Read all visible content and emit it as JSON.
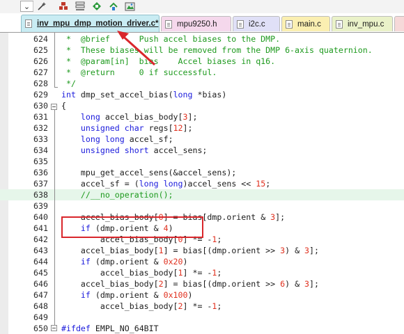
{
  "toolbar": {
    "icons": [
      "dropdown-chevron",
      "wand-icon",
      "build-icon",
      "rebuild-icon",
      "target-icon",
      "manage-icon",
      "pack-installer-icon"
    ]
  },
  "tabs": [
    {
      "label": "inv_mpu_dmp_motion_driver.c*",
      "active": true,
      "color": "#c9ecf3"
    },
    {
      "label": "mpu9250.h",
      "active": false,
      "color": "#f5d8ec"
    },
    {
      "label": "i2c.c",
      "active": false,
      "color": "#e0e0f7"
    },
    {
      "label": "main.c",
      "active": false,
      "color": "#fbefb1"
    },
    {
      "label": "inv_mpu.c",
      "active": false,
      "color": "#eaf2c9"
    }
  ],
  "code_lines": [
    {
      "num": "624",
      "segments": [
        {
          "c": "cm",
          "t": " *  @brief      Push accel biases to the DMP."
        }
      ]
    },
    {
      "num": "625",
      "segments": [
        {
          "c": "cm",
          "t": " *  These biases will be removed from the DMP 6-axis quaternion."
        }
      ]
    },
    {
      "num": "626",
      "segments": [
        {
          "c": "cm",
          "t": " *  @param[in]  bias    Accel biases in q16."
        }
      ]
    },
    {
      "num": "627",
      "segments": [
        {
          "c": "cm",
          "t": " *  @return     0 if successful."
        }
      ]
    },
    {
      "num": "628",
      "segments": [
        {
          "c": "cm",
          "t": " */"
        }
      ]
    },
    {
      "num": "629",
      "segments": [
        {
          "c": "kw",
          "t": "int"
        },
        {
          "c": "",
          "t": " dmp_set_accel_bias("
        },
        {
          "c": "kw",
          "t": "long"
        },
        {
          "c": "",
          "t": " *bias)"
        }
      ]
    },
    {
      "num": "630",
      "segments": [
        {
          "c": "",
          "t": "{"
        }
      ]
    },
    {
      "num": "631",
      "segments": [
        {
          "c": "",
          "t": "    "
        },
        {
          "c": "kw",
          "t": "long"
        },
        {
          "c": "",
          "t": " accel_bias_body["
        },
        {
          "c": "nm",
          "t": "3"
        },
        {
          "c": "",
          "t": "];"
        }
      ]
    },
    {
      "num": "632",
      "segments": [
        {
          "c": "",
          "t": "    "
        },
        {
          "c": "kw",
          "t": "unsigned char"
        },
        {
          "c": "",
          "t": " regs["
        },
        {
          "c": "nm",
          "t": "12"
        },
        {
          "c": "",
          "t": "];"
        }
      ]
    },
    {
      "num": "633",
      "segments": [
        {
          "c": "",
          "t": "    "
        },
        {
          "c": "kw",
          "t": "long long"
        },
        {
          "c": "",
          "t": " accel_sf;"
        }
      ]
    },
    {
      "num": "634",
      "segments": [
        {
          "c": "",
          "t": "    "
        },
        {
          "c": "kw",
          "t": "unsigned short"
        },
        {
          "c": "",
          "t": " accel_sens;"
        }
      ]
    },
    {
      "num": "635",
      "segments": [
        {
          "c": "",
          "t": ""
        }
      ]
    },
    {
      "num": "636",
      "segments": [
        {
          "c": "",
          "t": "    mpu_get_accel_sens(&accel_sens);"
        }
      ]
    },
    {
      "num": "637",
      "segments": [
        {
          "c": "",
          "t": "    accel_sf = ("
        },
        {
          "c": "kw",
          "t": "long long"
        },
        {
          "c": "",
          "t": ")accel_sens << "
        },
        {
          "c": "nm",
          "t": "15"
        },
        {
          "c": "",
          "t": ";"
        }
      ]
    },
    {
      "num": "638",
      "segments": [
        {
          "c": "",
          "t": "    "
        },
        {
          "c": "cm",
          "t": "//__no_operation();"
        }
      ]
    },
    {
      "num": "639",
      "segments": [
        {
          "c": "",
          "t": ""
        }
      ]
    },
    {
      "num": "640",
      "segments": [
        {
          "c": "",
          "t": "    accel_bias_body["
        },
        {
          "c": "nm",
          "t": "0"
        },
        {
          "c": "",
          "t": "] = bias[dmp.orient & "
        },
        {
          "c": "nm",
          "t": "3"
        },
        {
          "c": "",
          "t": "];"
        }
      ]
    },
    {
      "num": "641",
      "segments": [
        {
          "c": "",
          "t": "    "
        },
        {
          "c": "kw",
          "t": "if"
        },
        {
          "c": "",
          "t": " (dmp.orient & "
        },
        {
          "c": "nm",
          "t": "4"
        },
        {
          "c": "",
          "t": ")"
        }
      ]
    },
    {
      "num": "642",
      "segments": [
        {
          "c": "",
          "t": "        accel_bias_body["
        },
        {
          "c": "nm",
          "t": "0"
        },
        {
          "c": "",
          "t": "] *= -"
        },
        {
          "c": "nm",
          "t": "1"
        },
        {
          "c": "",
          "t": ";"
        }
      ]
    },
    {
      "num": "643",
      "segments": [
        {
          "c": "",
          "t": "    accel_bias_body["
        },
        {
          "c": "nm",
          "t": "1"
        },
        {
          "c": "",
          "t": "] = bias[(dmp.orient >> "
        },
        {
          "c": "nm",
          "t": "3"
        },
        {
          "c": "",
          "t": ") & "
        },
        {
          "c": "nm",
          "t": "3"
        },
        {
          "c": "",
          "t": "];"
        }
      ]
    },
    {
      "num": "644",
      "segments": [
        {
          "c": "",
          "t": "    "
        },
        {
          "c": "kw",
          "t": "if"
        },
        {
          "c": "",
          "t": " (dmp.orient & "
        },
        {
          "c": "nm",
          "t": "0x20"
        },
        {
          "c": "",
          "t": ")"
        }
      ]
    },
    {
      "num": "645",
      "segments": [
        {
          "c": "",
          "t": "        accel_bias_body["
        },
        {
          "c": "nm",
          "t": "1"
        },
        {
          "c": "",
          "t": "] *= -"
        },
        {
          "c": "nm",
          "t": "1"
        },
        {
          "c": "",
          "t": ";"
        }
      ]
    },
    {
      "num": "646",
      "segments": [
        {
          "c": "",
          "t": "    accel_bias_body["
        },
        {
          "c": "nm",
          "t": "2"
        },
        {
          "c": "",
          "t": "] = bias[(dmp.orient >> "
        },
        {
          "c": "nm",
          "t": "6"
        },
        {
          "c": "",
          "t": ") & "
        },
        {
          "c": "nm",
          "t": "3"
        },
        {
          "c": "",
          "t": "];"
        }
      ]
    },
    {
      "num": "647",
      "segments": [
        {
          "c": "",
          "t": "    "
        },
        {
          "c": "kw",
          "t": "if"
        },
        {
          "c": "",
          "t": " (dmp.orient & "
        },
        {
          "c": "nm",
          "t": "0x100"
        },
        {
          "c": "",
          "t": ")"
        }
      ]
    },
    {
      "num": "648",
      "segments": [
        {
          "c": "",
          "t": "        accel_bias_body["
        },
        {
          "c": "nm",
          "t": "2"
        },
        {
          "c": "",
          "t": "] *= -"
        },
        {
          "c": "nm",
          "t": "1"
        },
        {
          "c": "",
          "t": ";"
        }
      ]
    },
    {
      "num": "649",
      "segments": [
        {
          "c": "",
          "t": ""
        }
      ]
    },
    {
      "num": "650",
      "segments": [
        {
          "c": "kw",
          "t": "#ifdef"
        },
        {
          "c": "",
          "t": " EMPL_NO_64BIT"
        }
      ]
    }
  ],
  "highlighted_line": "638",
  "colors": {
    "comment": "#1e9a1e",
    "keyword": "#1a1adc",
    "number": "#e0301e",
    "annotation": "#d9262b"
  }
}
